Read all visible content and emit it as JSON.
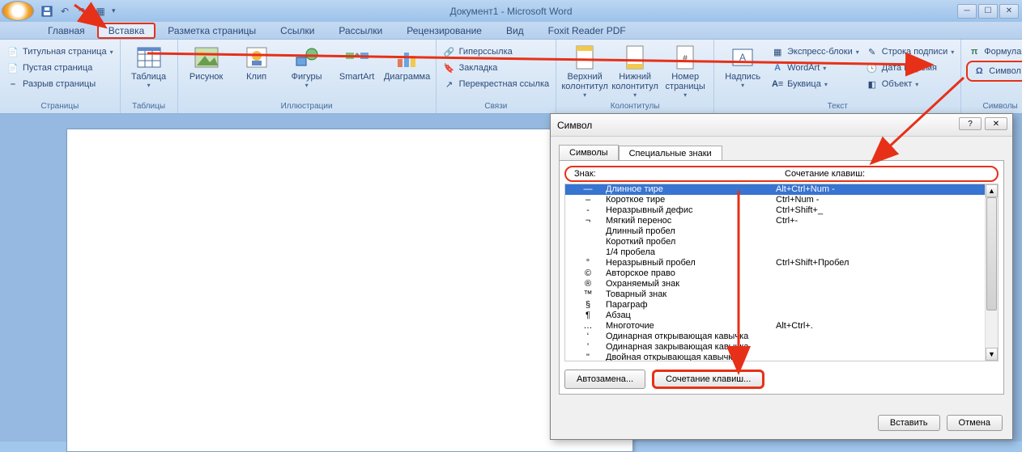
{
  "titlebar": {
    "title": "Документ1 - Microsoft Word"
  },
  "tabs": {
    "home": "Главная",
    "insert": "Вставка",
    "layout": "Разметка страницы",
    "refs": "Ссылки",
    "mail": "Рассылки",
    "review": "Рецензирование",
    "view": "Вид",
    "foxit": "Foxit Reader PDF"
  },
  "ribbon": {
    "pages": {
      "label": "Страницы",
      "title_page": "Титульная страница",
      "blank": "Пустая страница",
      "break": "Разрыв страницы"
    },
    "tables": {
      "label": "Таблицы",
      "table": "Таблица"
    },
    "illus": {
      "label": "Иллюстрации",
      "pic": "Рисунок",
      "clip": "Клип",
      "shapes": "Фигуры",
      "smartart": "SmartArt",
      "chart": "Диаграмма"
    },
    "links": {
      "label": "Связи",
      "hyper": "Гиперссылка",
      "bookmark": "Закладка",
      "crossref": "Перекрестная ссылка"
    },
    "hf": {
      "label": "Колонтитулы",
      "header": "Верхний колонтитул",
      "footer": "Нижний колонтитул",
      "pagenum": "Номер страницы"
    },
    "text": {
      "label": "Текст",
      "textbox": "Надпись",
      "quickparts": "Экспресс-блоки",
      "wordart": "WordArt",
      "dropcap": "Буквица",
      "sigline": "Строка подписи",
      "datetime": "Дата и время",
      "object": "Объект"
    },
    "symbols": {
      "label": "Символы",
      "formula": "Формула",
      "symbol": "Символ"
    }
  },
  "dialog": {
    "title": "Символ",
    "tab_symbols": "Символы",
    "tab_special": "Специальные знаки",
    "hdr_sign": "Знак:",
    "hdr_shortcut": "Сочетание клавиш:",
    "rows": [
      {
        "sym": "—",
        "name": "Длинное тире",
        "sc": "Alt+Ctrl+Num -"
      },
      {
        "sym": "–",
        "name": "Короткое тире",
        "sc": "Ctrl+Num -"
      },
      {
        "sym": "-",
        "name": "Неразрывный дефис",
        "sc": "Ctrl+Shift+_"
      },
      {
        "sym": "¬",
        "name": "Мягкий перенос",
        "sc": "Ctrl+-"
      },
      {
        "sym": "",
        "name": "Длинный пробел",
        "sc": ""
      },
      {
        "sym": "",
        "name": "Короткий пробел",
        "sc": ""
      },
      {
        "sym": "",
        "name": "1/4 пробела",
        "sc": ""
      },
      {
        "sym": "°",
        "name": "Неразрывный пробел",
        "sc": "Ctrl+Shift+Пробел"
      },
      {
        "sym": "©",
        "name": "Авторское право",
        "sc": ""
      },
      {
        "sym": "®",
        "name": "Охраняемый знак",
        "sc": ""
      },
      {
        "sym": "™",
        "name": "Товарный знак",
        "sc": ""
      },
      {
        "sym": "§",
        "name": "Параграф",
        "sc": ""
      },
      {
        "sym": "¶",
        "name": "Абзац",
        "sc": ""
      },
      {
        "sym": "…",
        "name": "Многоточие",
        "sc": "Alt+Ctrl+."
      },
      {
        "sym": "‘",
        "name": "Одинарная открывающая кавычка",
        "sc": ""
      },
      {
        "sym": "’",
        "name": "Одинарная закрывающая кавычка",
        "sc": ""
      },
      {
        "sym": "\"",
        "name": "Двойная открывающая кавычка",
        "sc": ""
      }
    ],
    "btn_autocorrect": "Автозамена...",
    "btn_shortcut": "Сочетание клавиш...",
    "btn_insert": "Вставить",
    "btn_cancel": "Отмена"
  }
}
